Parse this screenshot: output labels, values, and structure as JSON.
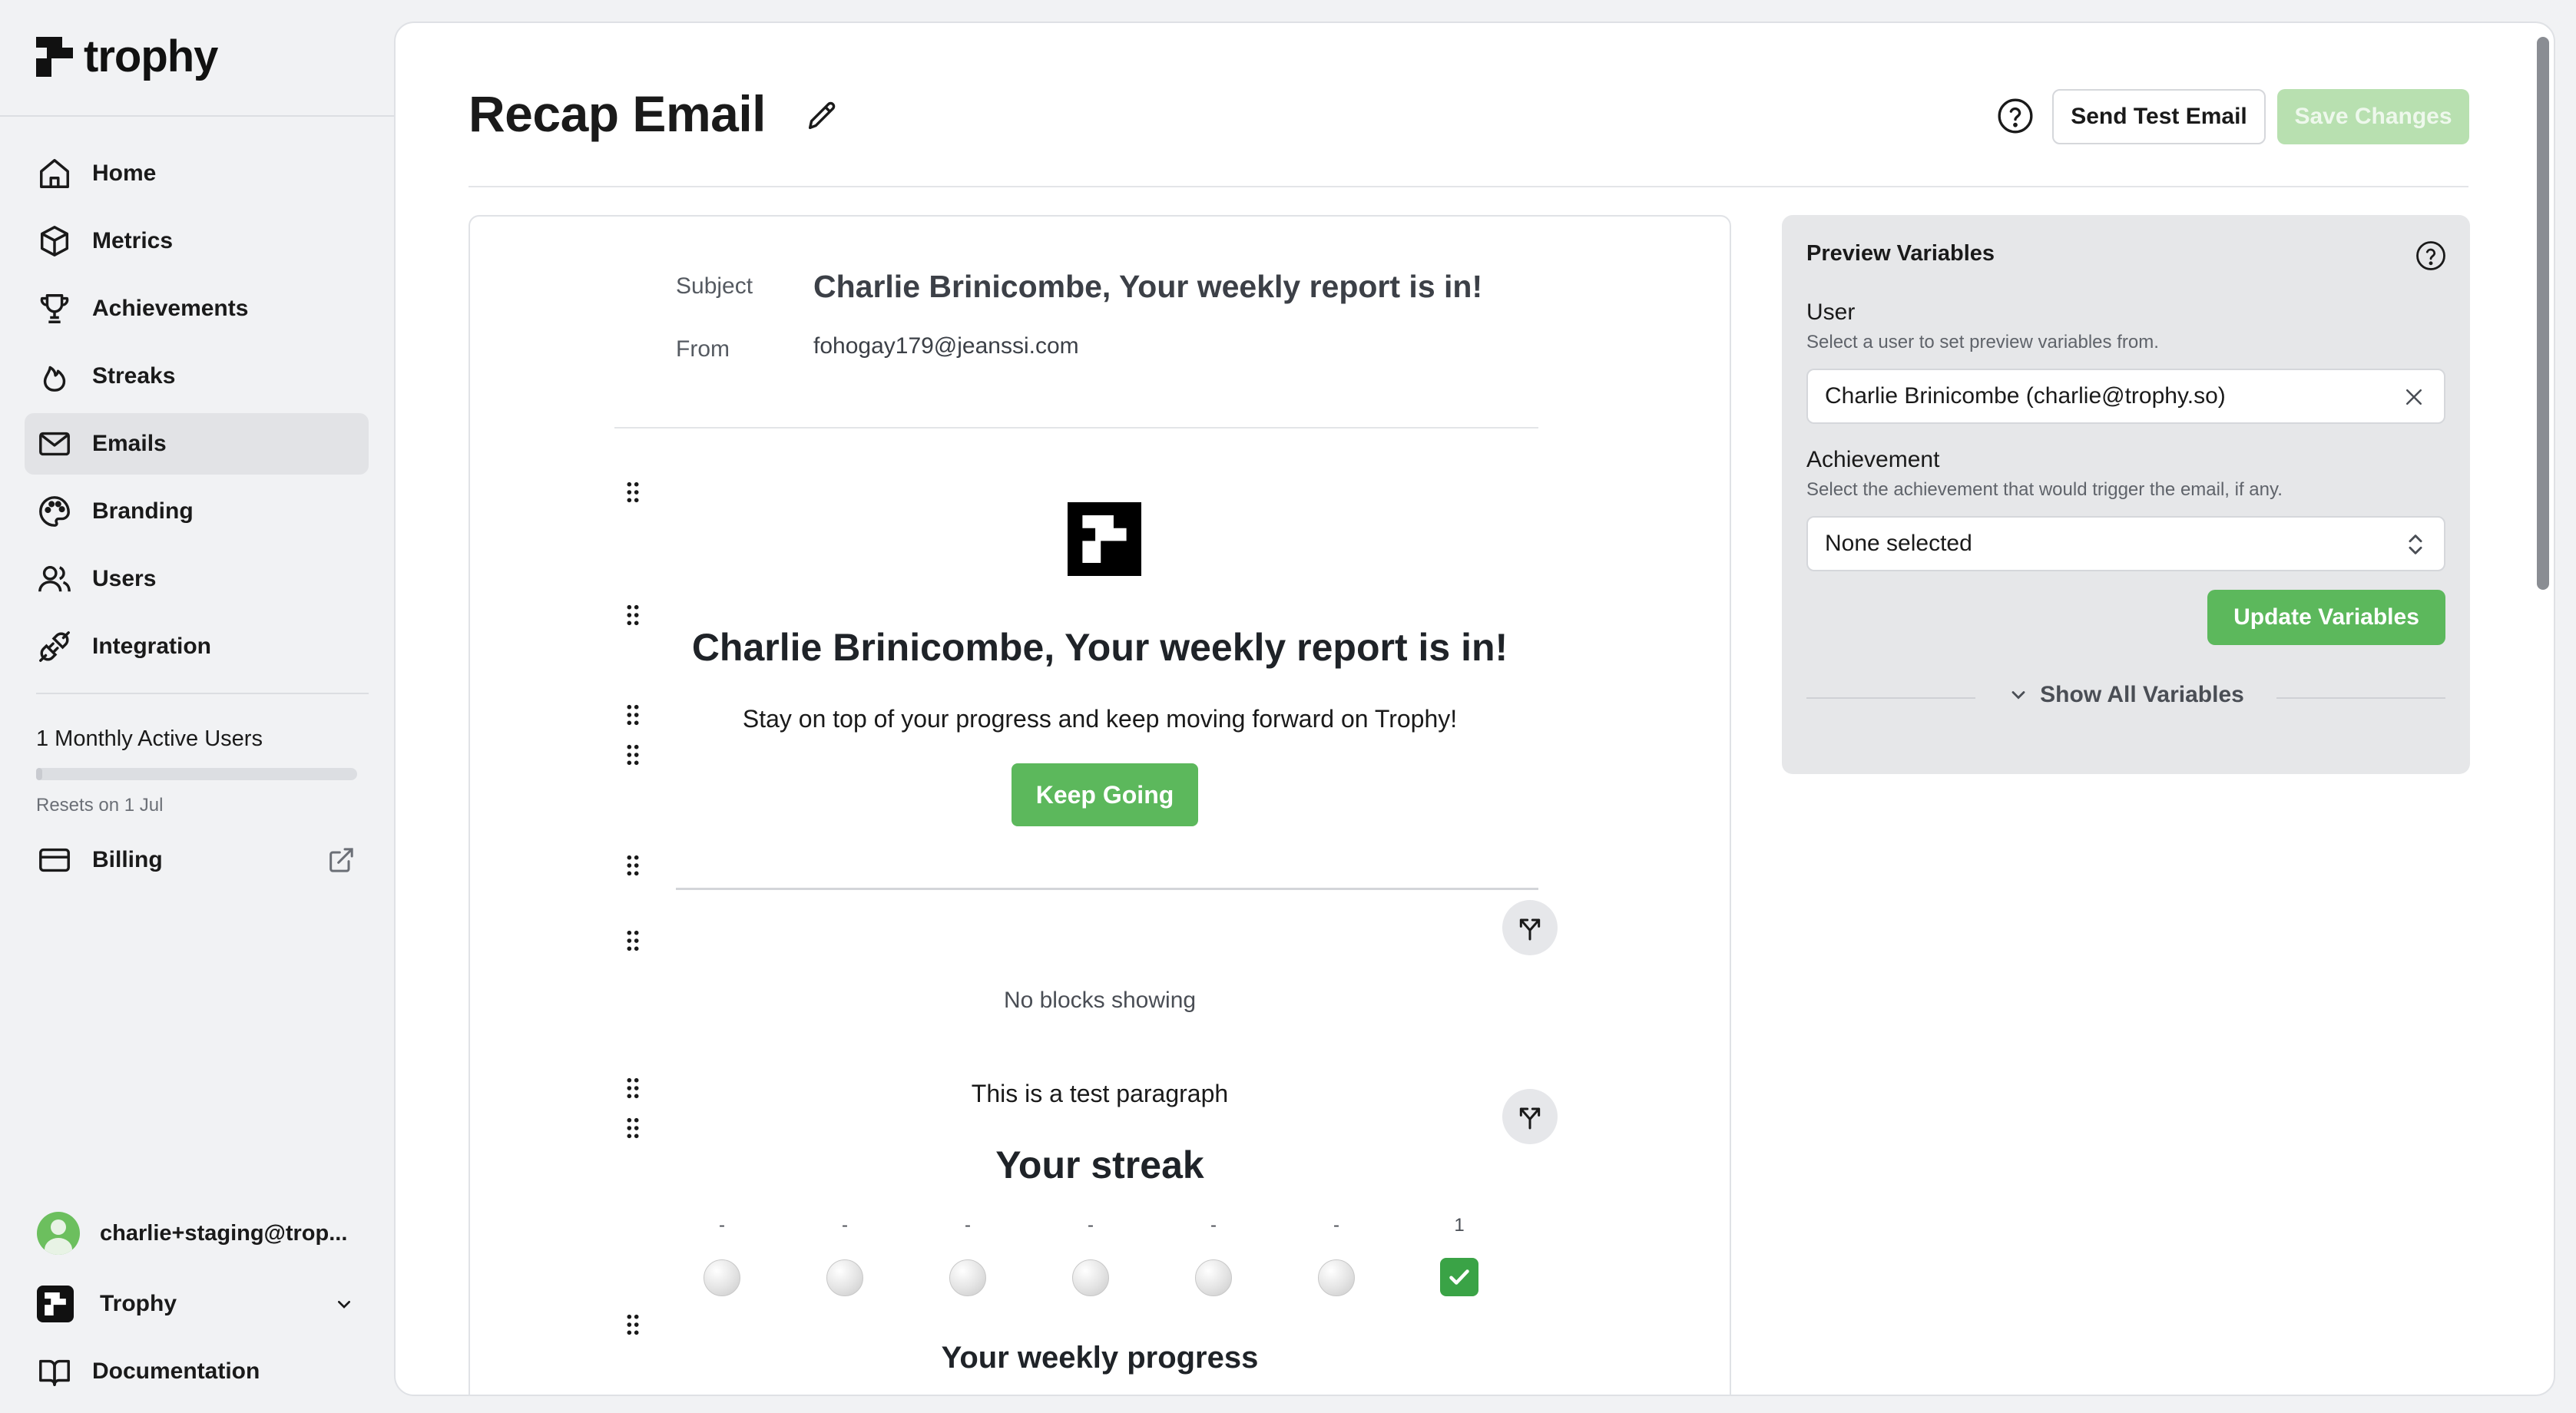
{
  "brand": {
    "name": "trophy",
    "accent": "#5cb85c"
  },
  "sidebar": {
    "items": [
      {
        "label": "Home",
        "icon": "home-icon"
      },
      {
        "label": "Metrics",
        "icon": "cube-icon"
      },
      {
        "label": "Achievements",
        "icon": "trophy-icon"
      },
      {
        "label": "Streaks",
        "icon": "flame-icon"
      },
      {
        "label": "Emails",
        "icon": "mail-icon",
        "active": true
      },
      {
        "label": "Branding",
        "icon": "palette-icon"
      },
      {
        "label": "Users",
        "icon": "users-icon"
      },
      {
        "label": "Integration",
        "icon": "plug-icon"
      }
    ],
    "mau_label": "1 Monthly Active Users",
    "mau_fraction": 0.02,
    "reset_text": "Resets on 1 Jul",
    "billing_label": "Billing",
    "user_email": "charlie+staging@trop...",
    "org_name": "Trophy",
    "docs_label": "Documentation"
  },
  "header": {
    "title": "Recap Email",
    "send_test_label": "Send Test Email",
    "save_label": "Save Changes"
  },
  "email": {
    "subject_label": "Subject",
    "subject": "Charlie Brinicombe, Your weekly report is in!",
    "from_label": "From",
    "from": "fohogay179@jeanssi.com",
    "heading": "Charlie Brinicombe, Your weekly report is in!",
    "intro": "Stay on top of your progress and keep moving forward on Trophy!",
    "cta_label": "Keep Going",
    "no_blocks": "No blocks showing",
    "test_paragraph": "This is a test paragraph",
    "streak_heading": "Your streak",
    "streak_days": [
      {
        "label": "-",
        "done": false
      },
      {
        "label": "-",
        "done": false
      },
      {
        "label": "-",
        "done": false
      },
      {
        "label": "-",
        "done": false
      },
      {
        "label": "-",
        "done": false
      },
      {
        "label": "-",
        "done": false
      },
      {
        "label": "1",
        "done": true
      }
    ],
    "progress_heading": "Your weekly progress"
  },
  "vars": {
    "title": "Preview Variables",
    "user_label": "User",
    "user_hint": "Select a user to set preview variables from.",
    "user_value": "Charlie Brinicombe (charlie@trophy.so)",
    "achievement_label": "Achievement",
    "achievement_hint": "Select the achievement that would trigger the email, if any.",
    "achievement_value": "None selected",
    "update_label": "Update Variables",
    "show_all_label": "Show All Variables"
  }
}
